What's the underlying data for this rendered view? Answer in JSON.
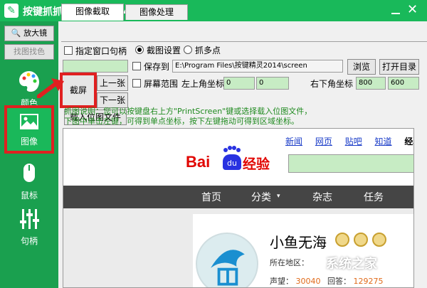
{
  "window": {
    "title": "按键抓抓辅助工具2014.00.14006",
    "close_glyph": "✕"
  },
  "sidebar": {
    "magnifier_label": "放大镜",
    "pick_color_label": "找图找色",
    "items": [
      {
        "label": "颜色",
        "icon": "palette-icon"
      },
      {
        "label": "图像",
        "icon": "image-icon",
        "active": true
      },
      {
        "label": "鼠标",
        "icon": "mouse-icon"
      },
      {
        "label": "句柄",
        "icon": "sliders-icon"
      }
    ]
  },
  "tabs": [
    {
      "label": "图像截取",
      "active": true
    },
    {
      "label": "图像处理",
      "active": false
    }
  ],
  "capture": {
    "specify_window_label": "指定窗口句柄",
    "screenshot_settings_label": "截图设置",
    "grab_points_label": "抓多点",
    "save_to_label": "保存到",
    "save_path": "E:\\Program Files\\按键精灵2014\\screen",
    "browse_label": "浏览",
    "open_dir_label": "打开目录",
    "screen_range_label": "屏幕范围",
    "top_left_label": "左上角坐标",
    "top_left_x": "0",
    "top_left_y": "0",
    "bottom_right_label": "右下角坐标",
    "bottom_right_x": "800",
    "bottom_right_y": "600",
    "capture_label": "截屏",
    "prev_label": "上一张",
    "next_label": "下一张",
    "load_image_label": "载入位图文件",
    "hint_line1": "抓图说明：您可以按键盘右上方\"PrintScreen\"键或选择载入位图文件，",
    "hint_line2": "下图中单击左键，可得到单点坐标，按下左键拖动可得到区域坐标。"
  },
  "preview": {
    "links": [
      "新闻",
      "网页",
      "贴吧",
      "知道",
      "经验"
    ],
    "logo_bai": "Bai",
    "logo_du": "du",
    "logo_jingyan": "经验",
    "nav": [
      "首页",
      "分类",
      "杂志",
      "任务"
    ],
    "profile_name": "小鱼无海",
    "location_label": "所在地区：",
    "stats_prefix": "声望：",
    "stats_value1": "30040",
    "stats_mid": "回答：",
    "stats_value2": "129275"
  },
  "watermark": "系统之家",
  "colors": {
    "accent_green": "#1aa04f",
    "highlight_red": "#e02020",
    "hint_green": "#1f8a1f"
  }
}
